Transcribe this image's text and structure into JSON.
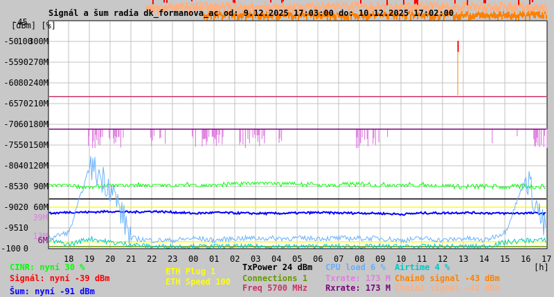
{
  "title": "Signál a šum radia dk_formanova_ac od: 9.12.2025 17:03:00 do: 10.12.2025 17:02:00",
  "chart_data": {
    "type": "line",
    "title": "Signál a šum radia dk_formanova_ac od: 9.12.2025 17:03:00 do: 10.12.2025 17:02:00",
    "xlabel": "[h]",
    "ylabel": "[dBm] [%]",
    "x_ticks": [
      "18",
      "19",
      "20",
      "21",
      "22",
      "23",
      "00",
      "01",
      "02",
      "03",
      "04",
      "05",
      "06",
      "07",
      "08",
      "09",
      "10",
      "11",
      "12",
      "13",
      "14",
      "15",
      "16",
      "17"
    ],
    "y_ticks_dbm": [
      "-45",
      "-50",
      "-55",
      "-60",
      "-65",
      "-70",
      "-75",
      "-80",
      "-85",
      "-90",
      "-95",
      "-100"
    ],
    "y_ticks_pct": [
      "100",
      "90",
      "80",
      "70",
      "60",
      "50",
      "40",
      "30",
      "20",
      "10",
      "0"
    ],
    "y_ticks_rate": [
      "300M",
      "270M",
      "240M",
      "210M",
      "180M",
      "150M",
      "120M",
      "90M",
      "60M"
    ],
    "extra_ticks": [
      {
        "label": "39M",
        "color": "#e080e0"
      },
      {
        "label": "13M",
        "color": "#e080e0"
      },
      {
        "label": "6M",
        "color": "#800080"
      }
    ],
    "ylim_dbm": [
      -100,
      -45
    ],
    "ylim_pct": [
      0,
      110
    ],
    "grid": true,
    "x_hours": [
      0,
      1,
      2,
      3,
      4,
      5,
      6,
      7,
      8,
      9,
      10,
      11,
      12,
      13,
      14,
      15,
      16,
      17,
      18,
      19,
      20,
      21,
      22,
      23,
      24
    ],
    "series": [
      {
        "name": "CINR",
        "unit": "%",
        "color": "#00ff00",
        "values": [
          30.7,
          30.7,
          29.5,
          30.5,
          30.7,
          30.7,
          30.7,
          30.7,
          30.7,
          31.2,
          31.5,
          31.3,
          31.4,
          30.7,
          30.7,
          31.2,
          30.7,
          30.7,
          30.7,
          30.2,
          30.0,
          30.0,
          30.0,
          30.0,
          30.0
        ]
      },
      {
        "name": "Šum",
        "unit": "dBm",
        "color": "#0000ff",
        "values": [
          -91.5,
          -91.2,
          -91.2,
          -91.0,
          -91.2,
          -91.0,
          -91.2,
          -91.5,
          -91.3,
          -91.4,
          -91.5,
          -91.5,
          -91.4,
          -91.3,
          -91.4,
          -91.4,
          -91.5,
          -91.7,
          -91.4,
          -91.4,
          -91.3,
          -91.4,
          -91.5,
          -91.4,
          -91.5
        ]
      },
      {
        "name": "CPU load",
        "unit": "%",
        "color": "#66b0ff",
        "values": [
          5,
          8,
          40,
          30,
          5,
          4,
          4,
          5,
          4,
          5,
          5,
          5,
          5,
          5,
          5,
          5,
          5,
          4,
          5,
          4,
          5,
          4,
          8,
          35,
          6
        ]
      },
      {
        "name": "Airtime",
        "unit": "%",
        "color": "#00c8c8",
        "values": [
          4,
          2,
          5,
          3,
          2,
          1,
          1,
          1,
          1,
          1,
          1,
          1,
          1,
          1,
          1,
          1,
          1,
          1,
          1,
          1,
          1,
          1,
          3,
          4,
          4
        ]
      }
    ],
    "constant_lines": [
      {
        "name": "Freq 5700 MHz",
        "color": "#cc3366",
        "value_dbm": -63.3
      },
      {
        "name": "Rxrate",
        "color": "#800080",
        "value_rate_m": 173
      },
      {
        "name": "TxPower",
        "color": "#000000",
        "value_dbm": -88
      },
      {
        "name": "ETH Speed",
        "color": "#ffff00",
        "value_rate_m": 60
      },
      {
        "name": "ETH Plug",
        "color": "#ffff00",
        "value_pct": 3.3
      },
      {
        "name": "Connections",
        "color": "#669900",
        "value_pct": 1
      }
    ],
    "txrate_bursts_hours": [
      [
        1.9,
        2.6
      ],
      [
        2.9,
        3.6
      ],
      [
        4.9,
        5.1
      ],
      [
        5.3,
        5.4
      ],
      [
        5.6,
        5.7
      ],
      [
        6.9,
        8.4
      ],
      [
        9.1,
        10.4
      ],
      [
        11.0,
        11.2
      ],
      [
        14.8,
        15.9
      ],
      [
        16.3,
        16.4
      ],
      [
        21.3,
        21.4
      ],
      [
        22.5,
        22.6
      ],
      [
        23.3,
        24.0
      ]
    ],
    "txrate_range_m": [
      145,
      173
    ],
    "signal_spike": {
      "hour": 19.7,
      "dbm_min": -64,
      "dbm_max": -50
    }
  },
  "legend": {
    "cinr": "CINR: nyní 30 %",
    "signal": "Signál: nyní -39 dBm",
    "noise": "Šum: nyní -91 dBm",
    "eth_plug": "ETH Plug 1",
    "eth_speed": "ETH Speed 100",
    "txpower": "TxPower 24 dBm",
    "connections_label": "Connections",
    "connections_value": "1",
    "freq": "Freq 5700 MHz",
    "cpu": "CPU load 6 %",
    "txrate": "Txrate: 173 M",
    "rxrate": "Rxrate: 173 M",
    "airtime": "Airtime 4 %",
    "chain0": "Chain0 signal -43 dBm",
    "chain1": "Chain1 signal -42 dBm"
  },
  "colors": {
    "cinr": "#00ff00",
    "signal": "#ff0000",
    "noise": "#0000ff",
    "eth": "#ffff00",
    "txpower": "#000000",
    "connections": "#669900",
    "freq": "#cc3366",
    "cpu": "#66b0ff",
    "txrate": "#e080e0",
    "rxrate": "#800080",
    "airtime": "#00c8c8",
    "chain0": "#ff8000",
    "chain1": "#ffb080"
  }
}
